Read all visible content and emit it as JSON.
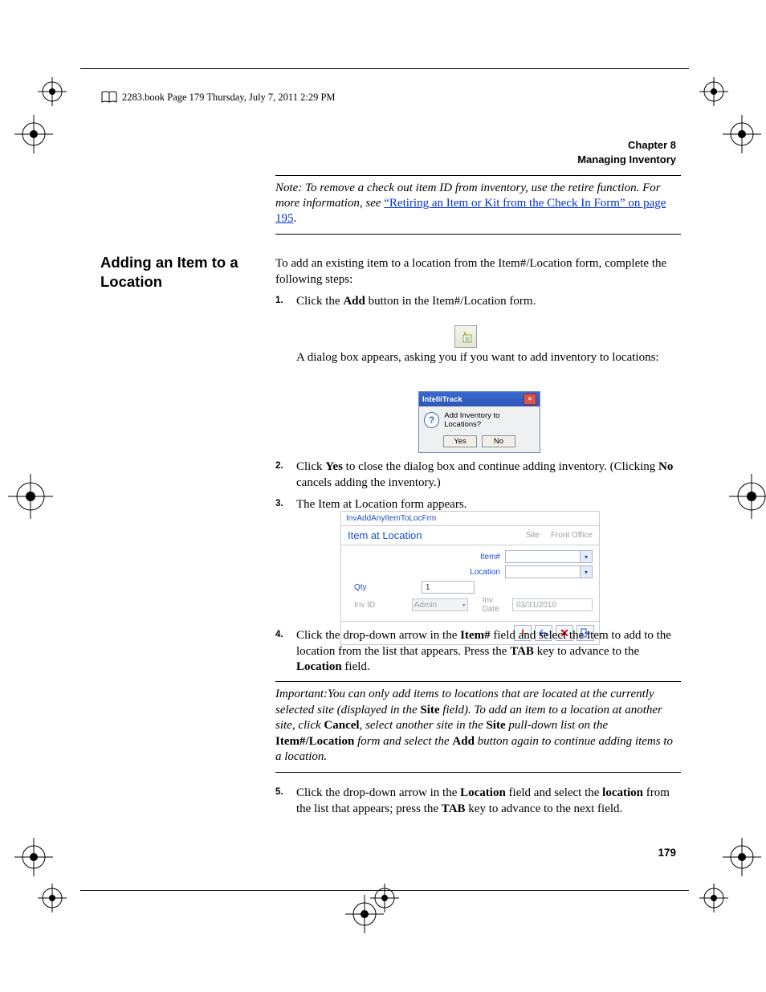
{
  "book_line": "2283.book  Page 179  Thursday, July 7, 2011  2:29 PM",
  "header": {
    "chapter": "Chapter 8",
    "title": "Managing Inventory"
  },
  "note": {
    "prefix": "Note:   To remove a check out item ID from inventory, use the retire function. For more information, see ",
    "link": "“Retiring an Item or Kit from the Check In Form” on page 195",
    "suffix": "."
  },
  "heading": "Adding an Item to a Location",
  "intro": "To add an existing item to a location from the Item#/Location form, complete the following steps:",
  "step1": {
    "num": "1.",
    "t1": "Click the ",
    "b1": "Add",
    "t2": " button in the Item#/Location form."
  },
  "after_icon": "A dialog box appears, asking you if you want to add inventory to locations:",
  "dialog": {
    "title": "IntelliTrack",
    "msg": "Add Inventory to Locations?",
    "yes": "Yes",
    "no": "No"
  },
  "step2": {
    "num": "2.",
    "t1": "Click ",
    "b1": "Yes",
    "t2": " to close the dialog box and continue adding inventory. (Clicking ",
    "b2": "No",
    "t3": " cancels adding the inventory.)"
  },
  "step3": {
    "num": "3.",
    "t1": "The Item at Location form appears."
  },
  "form": {
    "tab": "InvAddAnyItemToLocFrm",
    "title": "Item at Location",
    "site_label": "Site",
    "site_value": "Front Office",
    "item_label": "Item#",
    "location_label": "Location",
    "qty_label": "Qty",
    "qty_value": "1",
    "invid_label": "Inv ID",
    "invid_value": "Admin",
    "invdate_label": "Inv Date",
    "invdate_value": "03/31/2010"
  },
  "step4": {
    "num": "4.",
    "t1": "Click the drop-down arrow in the ",
    "b1": "Item#",
    "t2": " field and select the item to add to the location from the list that appears. Press the ",
    "b2": "TAB",
    "t3": " key to advance to the ",
    "b3": "Location",
    "t4": " field."
  },
  "important": {
    "t1": "Important:You can only add items to locations that are located at the currently selected site (displayed in the ",
    "b1": "Site",
    "t2": " field). To add an item to a location at another site, click ",
    "b2": "Cancel",
    "t3": ", select another site in the ",
    "b3": "Site",
    "t4": " pull-down list on the ",
    "b4": "Item#/Location",
    "t5": " form and select the ",
    "b5": "Add",
    "t6": " button again to continue adding items to a location."
  },
  "step5": {
    "num": "5.",
    "t1": "Click the drop-down arrow in the ",
    "b1": "Location",
    "t2": " field and select the ",
    "b2": "location",
    "t3": " from the list that appears; press the ",
    "b3": "TAB",
    "t4": " key to advance to the next field."
  },
  "page_number": "179"
}
